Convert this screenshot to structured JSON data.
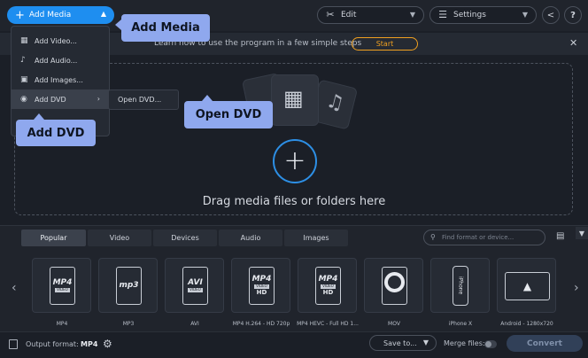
{
  "header": {
    "add_media_label": "Add Media",
    "edit_label": "Edit",
    "settings_label": "Settings",
    "help_label": "?"
  },
  "banner": {
    "text": "Learn how to use the program in a few simple steps",
    "start_label": "Start"
  },
  "add_menu": {
    "items": [
      {
        "label": "Add Video...",
        "icon": "video-icon"
      },
      {
        "label": "Add Audio...",
        "icon": "music-icon"
      },
      {
        "label": "Add Images...",
        "icon": "image-icon"
      },
      {
        "label": "Add DVD",
        "icon": "disc-icon"
      }
    ],
    "submenu_open_dvd": "Open DVD..."
  },
  "callouts": {
    "add_media": "Add Media",
    "add_dvd": "Add DVD",
    "open_dvd": "Open DVD"
  },
  "dropzone": {
    "text": "Drag media files or folders here"
  },
  "formats": {
    "tabs": [
      {
        "label": "Popular",
        "active": true
      },
      {
        "label": "Video",
        "active": false
      },
      {
        "label": "Devices",
        "active": false
      },
      {
        "label": "Audio",
        "active": false
      },
      {
        "label": "Images",
        "active": false
      }
    ],
    "search_placeholder": "Find format or device...",
    "items": [
      {
        "label": "MP4",
        "badge": "MP4",
        "icon": "mp4-file-icon"
      },
      {
        "label": "MP3",
        "badge": "mp3",
        "icon": "mp3-file-icon"
      },
      {
        "label": "AVI",
        "badge": "AVI",
        "icon": "avi-file-icon"
      },
      {
        "label": "MP4 H.264 - HD 720p",
        "badge": "MP4",
        "sub": "HD",
        "icon": "mp4-hd-file-icon"
      },
      {
        "label": "MP4 HEVC - Full HD 1...",
        "badge": "MP4",
        "sub": "HD",
        "icon": "mp4-hevc-file-icon"
      },
      {
        "label": "MOV",
        "icon": "quicktime-icon"
      },
      {
        "label": "iPhone X",
        "badge": "iPhone",
        "icon": "iphone-icon"
      },
      {
        "label": "Android - 1280x720",
        "icon": "android-tablet-icon"
      }
    ]
  },
  "bottom": {
    "output_format_label": "Output format:",
    "output_format_value": "MP4",
    "save_to_label": "Save to...",
    "merge_files_label": "Merge files:",
    "convert_label": "Convert"
  }
}
